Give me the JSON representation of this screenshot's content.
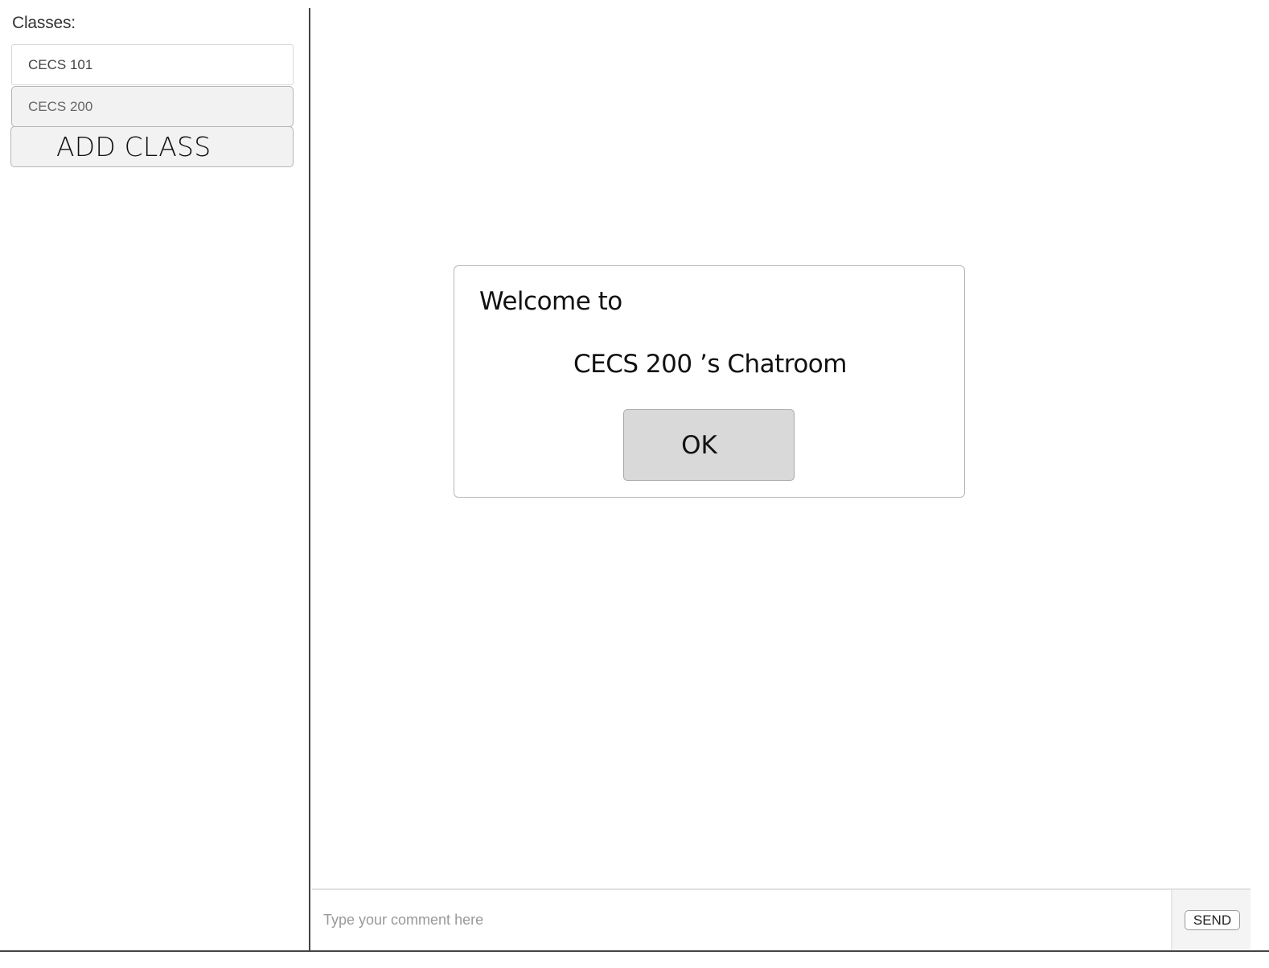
{
  "sidebar": {
    "title": "Classes:",
    "classes": [
      {
        "label": "CECS 101",
        "selected": false
      },
      {
        "label": "CECS 200",
        "selected": true
      }
    ],
    "add_class_label": "ADD CLASS"
  },
  "modal": {
    "welcome_text": "Welcome to",
    "room_name": "CECS 200",
    "room_suffix": "’s Chatroom",
    "ok_label": "OK"
  },
  "composer": {
    "placeholder": "Type your comment here",
    "value": "",
    "send_label": "SEND"
  },
  "colors": {
    "selected_item_bg": "#f2f2f2",
    "ok_button_bg": "#d9d9d9",
    "divider": "#444444"
  }
}
